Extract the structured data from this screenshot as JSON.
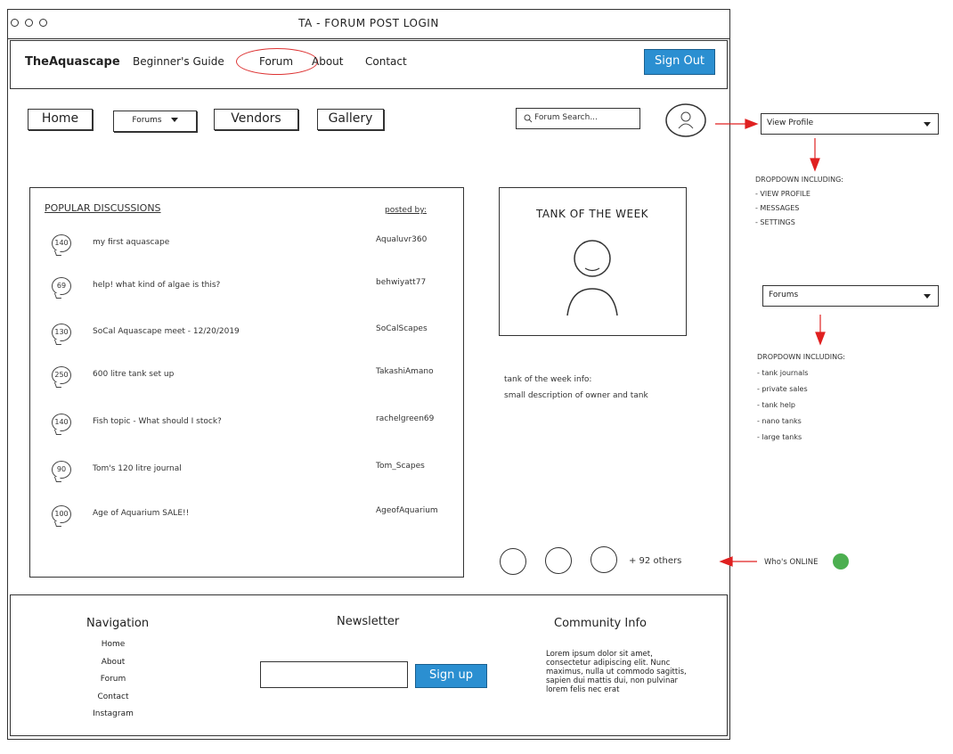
{
  "window": {
    "title": "TA - FORUM POST LOGIN"
  },
  "nav": {
    "brand": "TheAquascape",
    "links": [
      "Beginner's Guide",
      "Forum",
      "About",
      "Contact"
    ],
    "sign_out": "Sign Out"
  },
  "subnav": {
    "home": "Home",
    "forums": "Forums",
    "vendors": "Vendors",
    "gallery": "Gallery",
    "search_placeholder": "Forum Search..."
  },
  "discussions": {
    "title": "POPULAR DISCUSSIONS",
    "posted_by_label": "posted by:",
    "items": [
      {
        "count": "140",
        "title": "my first aquascape",
        "author": "Aqualuvr360"
      },
      {
        "count": "69",
        "title": "help! what kind of algae is this?",
        "author": "behwiyatt77"
      },
      {
        "count": "130",
        "title": "SoCal Aquascape meet - 12/20/2019",
        "author": "SoCalScapes"
      },
      {
        "count": "250",
        "title": "600 litre tank set up",
        "author": "TakashiAmano"
      },
      {
        "count": "140",
        "title": "Fish topic - What should I stock?",
        "author": "rachelgreen69"
      },
      {
        "count": "90",
        "title": "Tom's 120 litre journal",
        "author": "Tom_Scapes"
      },
      {
        "count": "100",
        "title": "Age of Aquarium SALE!!",
        "author": "AgeofAquarium"
      }
    ]
  },
  "tank_of_week": {
    "title": "TANK OF THE WEEK",
    "info_line1": "tank of the week info:",
    "info_line2": "small description of owner and tank"
  },
  "online": {
    "others_label": "+ 92 others"
  },
  "footer": {
    "navigation_title": "Navigation",
    "navigation_links": [
      "Home",
      "About",
      "Forum",
      "Contact",
      "Instagram"
    ],
    "newsletter_title": "Newsletter",
    "signup_label": "Sign up",
    "community_title": "Community Info",
    "community_text": "Lorem ipsum dolor sit amet, consectetur adipiscing elit. Nunc maximus, nulla ut commodo sagittis, sapien dui mattis dui, non pulvinar lorem felis nec erat"
  },
  "annotations": {
    "profile_dropdown": "View Profile",
    "profile_note_title": "DROPDOWN INCLUDING:",
    "profile_note_items": [
      "- VIEW PROFILE",
      "- MESSAGES",
      "- SETTINGS"
    ],
    "forums_dropdown": "Forums",
    "forums_note_title": "DROPDOWN INCLUDING:",
    "forums_note_items": [
      "- tank journals",
      "- private sales",
      "- tank help",
      "- nano tanks",
      "- large tanks"
    ],
    "online_label": "Who's ONLINE",
    "online_color": "#4caf50",
    "arrow_color": "#e02020",
    "accent_color": "#2b8fd1"
  }
}
